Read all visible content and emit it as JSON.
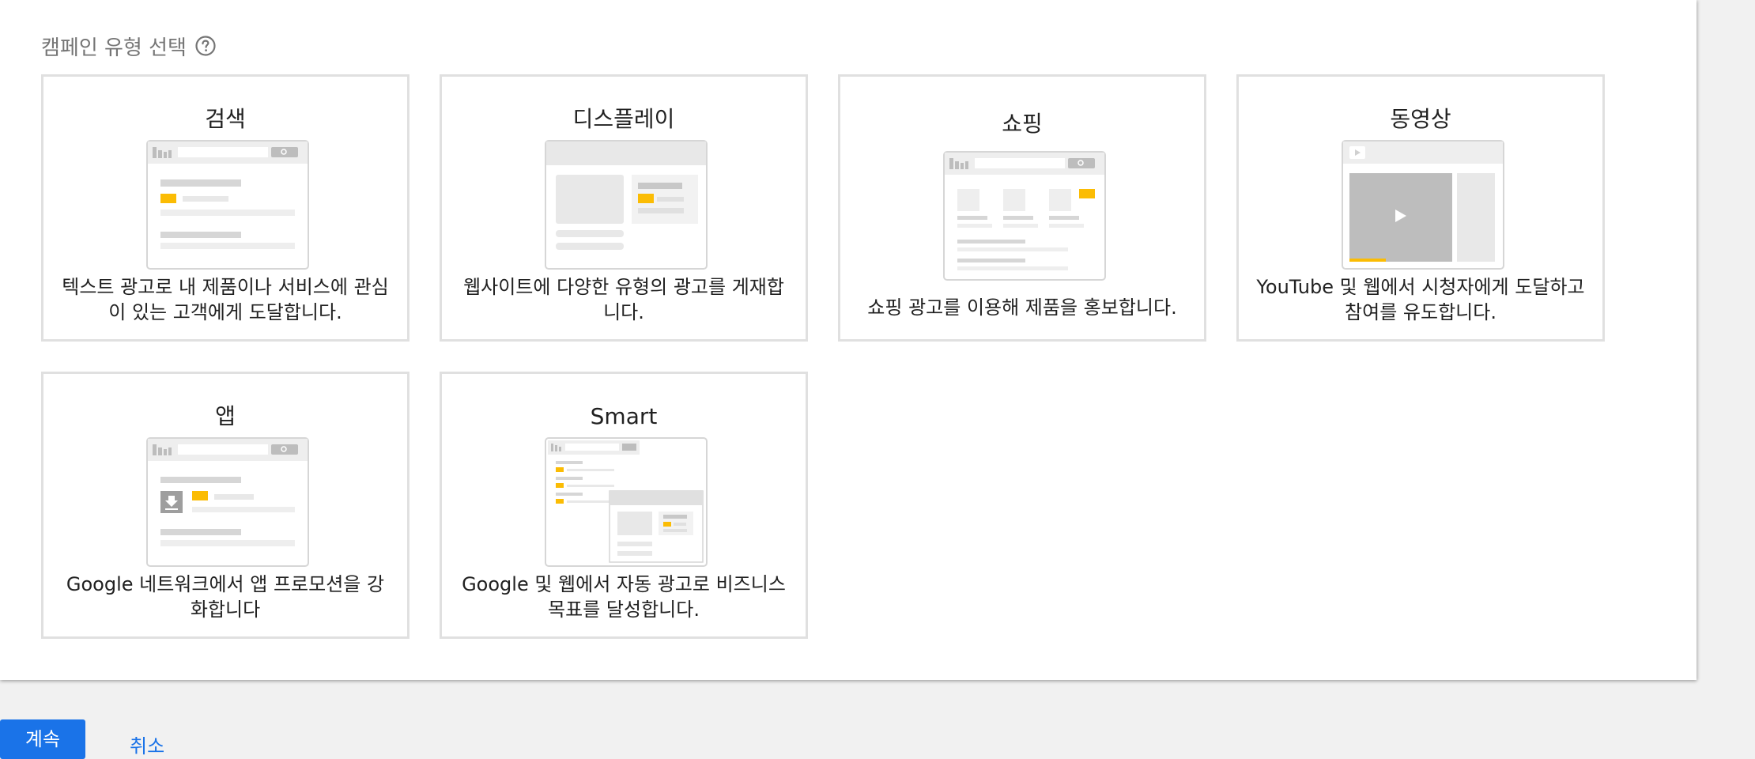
{
  "section": {
    "title": "캠페인 유형 선택",
    "help_icon": "help-circle-icon"
  },
  "cards": [
    {
      "title": "검색",
      "description": "텍스트 광고로 내 제품이나 서비스에 관심이 있는 고객에게 도달합니다."
    },
    {
      "title": "디스플레이",
      "description": "웹사이트에 다양한 유형의 광고를 게재합니다."
    },
    {
      "title": "쇼핑",
      "description": "쇼핑 광고를 이용해 제품을 홍보합니다."
    },
    {
      "title": "동영상",
      "description": "YouTube 및 웹에서 시청자에게 도달하고 참여를 유도합니다."
    },
    {
      "title": "앱",
      "description": "Google 네트워크에서 앱 프로모션을 강화합니다"
    },
    {
      "title": "Smart",
      "description": "Google 및 웹에서 자동 광고로 비즈니스 목표를 달성합니다."
    }
  ],
  "footer": {
    "continue_label": "계속",
    "cancel_label": "취소"
  },
  "colors": {
    "accent": "#1a73e8",
    "highlight": "#fbbc04",
    "border": "#e0e0e0"
  }
}
